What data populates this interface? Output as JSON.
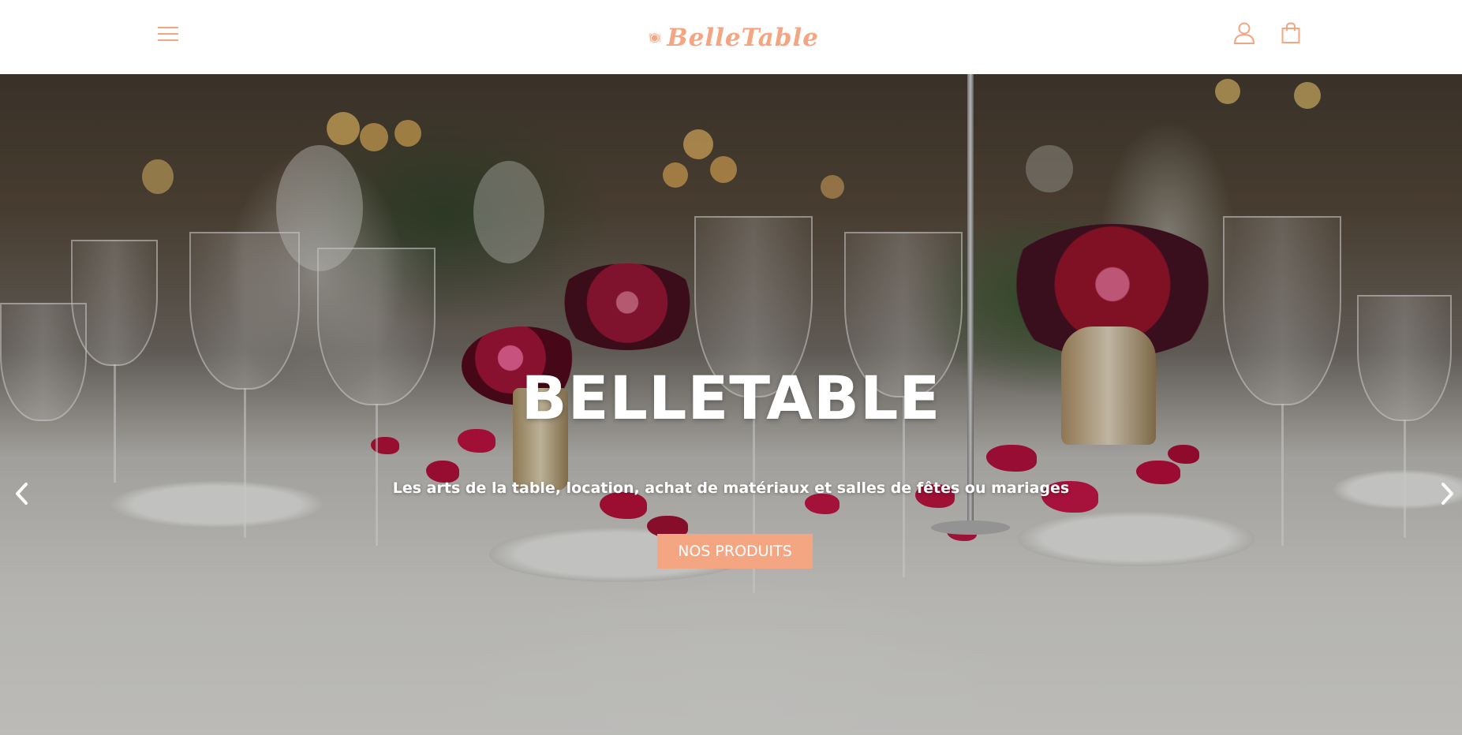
{
  "brand": {
    "name": "BelleTable",
    "accent_color": "#f4a582"
  },
  "header": {
    "menu_icon": "hamburger-menu-icon",
    "account_icon": "user-icon",
    "cart_icon": "shopping-bag-icon"
  },
  "hero": {
    "title": "BELLETABLE",
    "subtitle": "Les arts de la table, location, achat de matériaux et salles de fêtes ou mariages",
    "cta_label": "NOS PRODUITS",
    "prev_icon": "chevron-left-icon",
    "next_icon": "chevron-right-icon"
  }
}
